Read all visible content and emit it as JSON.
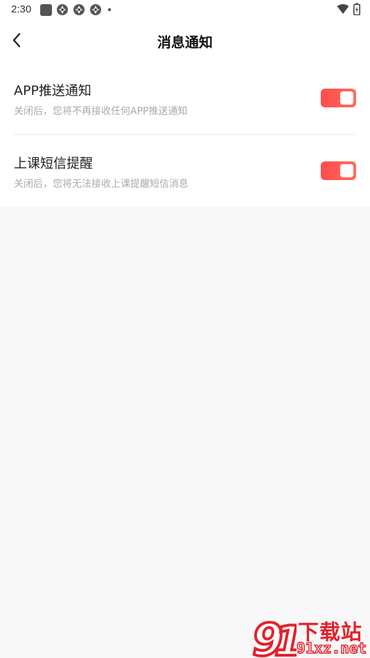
{
  "status_bar": {
    "time": "2:30"
  },
  "header": {
    "title": "消息通知"
  },
  "settings": [
    {
      "title": "APP推送通知",
      "description": "关闭后，您将不再接收任何APP推送通知",
      "enabled": true
    },
    {
      "title": "上课短信提醒",
      "description": "关闭后，您将无法接收上课提醒短信消息",
      "enabled": true
    }
  ],
  "watermark": {
    "title": "下载站",
    "url": "91xz.net"
  },
  "colors": {
    "toggle_on": "#ff5a52",
    "watermark": "#e3212b",
    "page_background": "#f8f8f8"
  },
  "icons": {
    "back": "chevron-left-icon",
    "wifi": "wifi-icon",
    "battery": "battery-icon"
  }
}
